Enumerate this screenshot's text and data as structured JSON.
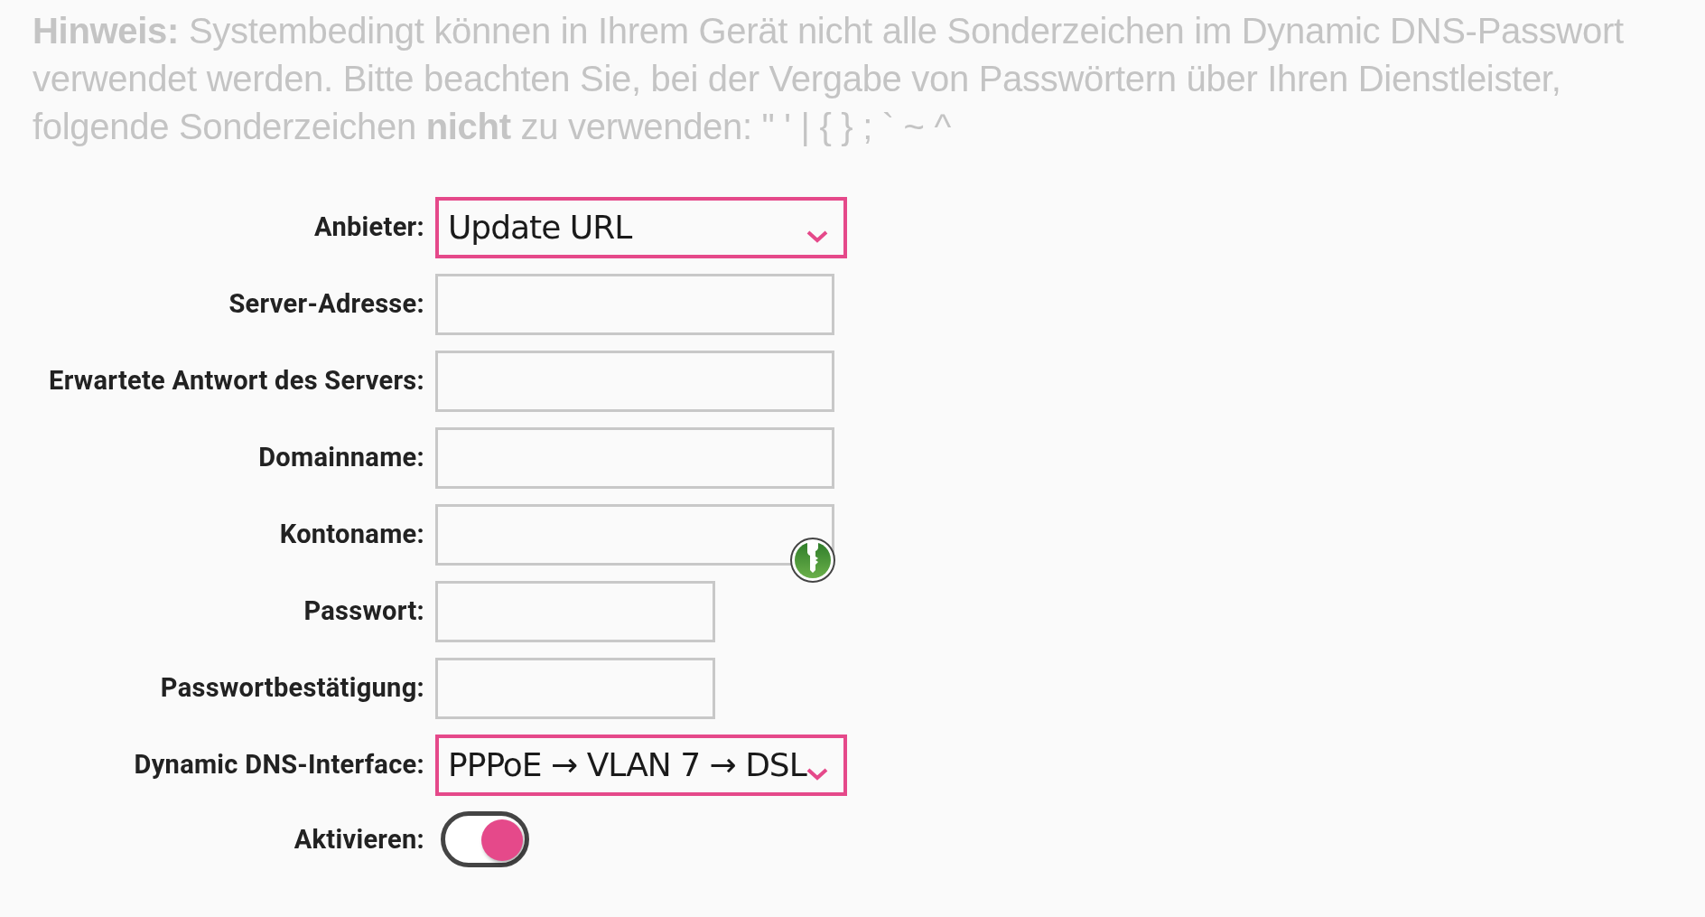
{
  "notice": "**Hinweis:** Systembedingt können in Ihrem Gerät nicht alle Sonderzeichen im Dynamic DNS-Passwort verwendet werden. Bitte beachten Sie, bei der Vergabe von Passwörtern über Ihren Dienstleister, folgende Sonderzeichen **nicht** zu verwenden: \" ' | { } ; ` ~ ^",
  "fields": [
    {
      "label": "Anbieter:",
      "kind": "select",
      "value": "Update URL",
      "key_overlay": false
    },
    {
      "label": "Server-Adresse:",
      "kind": "text",
      "key_overlay": false
    },
    {
      "label": "Erwartete Antwort des Servers:",
      "kind": "text",
      "key_overlay": false
    },
    {
      "label": "Domainname:",
      "kind": "text",
      "key_overlay": false
    },
    {
      "label": "Kontoname:",
      "kind": "text",
      "key_overlay": true
    },
    {
      "label": "Passwort:",
      "kind": "password",
      "key_overlay": false
    },
    {
      "label": "Passwortbestätigung:",
      "kind": "password",
      "key_overlay": false
    },
    {
      "label": "Dynamic DNS-Interface:",
      "kind": "select",
      "value": "PPPoE → VLAN 7 → DSL",
      "key_overlay": false
    },
    {
      "label": "Aktivieren:",
      "kind": "toggle",
      "on": true,
      "key_overlay": false
    }
  ]
}
